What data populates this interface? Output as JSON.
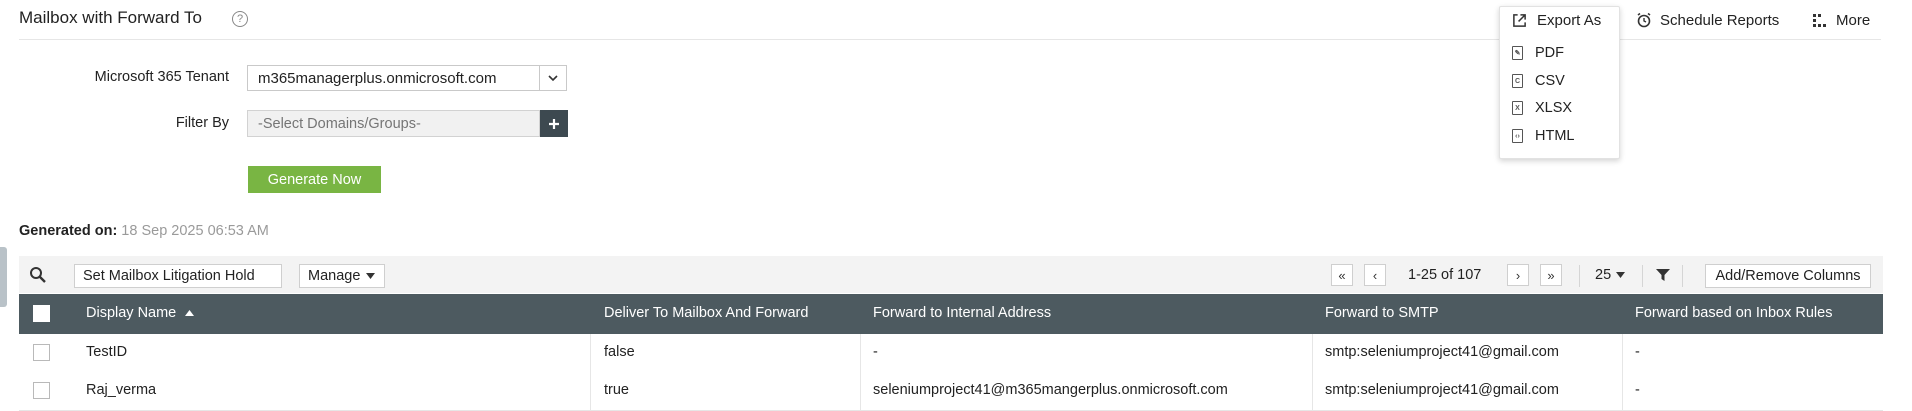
{
  "header": {
    "title": "Mailbox with Forward To",
    "help_icon": "?",
    "schedule_label": "Schedule Reports",
    "more_label": "More"
  },
  "export_menu": {
    "title": "Export As",
    "items": [
      {
        "label": "PDF",
        "icon": "pdf-icon"
      },
      {
        "label": "CSV",
        "icon": "csv-icon"
      },
      {
        "label": "XLSX",
        "icon": "xlsx-icon"
      },
      {
        "label": "HTML",
        "icon": "html-icon"
      }
    ]
  },
  "form": {
    "tenant_label": "Microsoft 365 Tenant",
    "tenant_value": "m365managerplus.onmicrosoft.com",
    "filter_label": "Filter By",
    "filter_placeholder": "-Select Domains/Groups-",
    "generate_label": "Generate Now"
  },
  "generated": {
    "label": "Generated on:",
    "value": "18 Sep 2025 06:53 AM"
  },
  "toolbar": {
    "litigation_label": "Set Mailbox Litigation Hold",
    "manage_label": "Manage",
    "page_info": "1-25 of 107",
    "page_size": "25",
    "columns_label": "Add/Remove Columns"
  },
  "table": {
    "columns": [
      "Display Name",
      "Deliver To Mailbox And Forward",
      "Forward to Internal Address",
      "Forward to SMTP",
      "Forward based on Inbox Rules"
    ],
    "sort_column": "Display Name",
    "rows": [
      {
        "name": "TestID",
        "deliver": "false",
        "internal": "-",
        "smtp": "smtp:seleniumproject41@gmail.com",
        "inbox_rules": "-"
      },
      {
        "name": "Raj_verma",
        "deliver": "true",
        "internal": "seleniumproject41@m365mangerplus.onmicrosoft.com",
        "smtp": "smtp:seleniumproject41@gmail.com",
        "inbox_rules": "-"
      }
    ]
  },
  "colors": {
    "accent_green": "#79b543",
    "table_header": "#4d5a60",
    "dark_button": "#3d4950"
  }
}
